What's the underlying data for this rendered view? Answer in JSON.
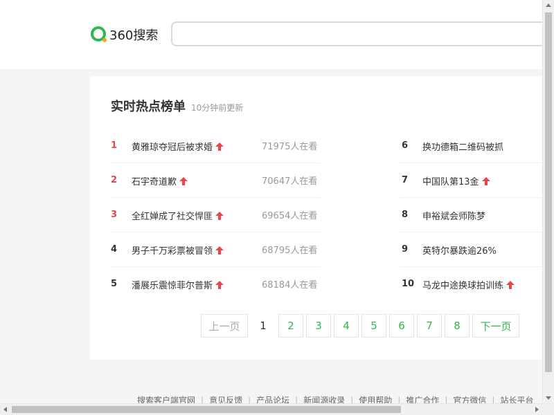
{
  "header": {
    "logo_text": "360搜索",
    "search_value": "",
    "search_placeholder": ""
  },
  "panel": {
    "title": "实时热点榜单",
    "subtitle": "10分钟前更新",
    "left_items": [
      {
        "rank": "1",
        "title": "黄雅琼夺冠后被求婚",
        "views": "71975人在看",
        "trend": "up",
        "rank_color": "#e9464a"
      },
      {
        "rank": "2",
        "title": "石宇奇道歉",
        "views": "70647人在看",
        "trend": "up",
        "rank_color": "#e9464a"
      },
      {
        "rank": "3",
        "title": "全红婵成了社交悍匪",
        "views": "69654人在看",
        "trend": "up",
        "rank_color": "#e9464a"
      },
      {
        "rank": "4",
        "title": "男子千万彩票被冒领",
        "views": "68795人在看",
        "trend": "up",
        "rank_color": "#333333"
      },
      {
        "rank": "5",
        "title": "潘展乐震惊菲尔普斯",
        "views": "68184人在看",
        "trend": "up",
        "rank_color": "#333333"
      }
    ],
    "right_items": [
      {
        "rank": "6",
        "title": "换功德箱二维码被抓",
        "trend": "none"
      },
      {
        "rank": "7",
        "title": "中国队第13金",
        "trend": "up"
      },
      {
        "rank": "8",
        "title": "申裕斌会师陈梦",
        "trend": "none"
      },
      {
        "rank": "9",
        "title": "英特尔暴跌逾26%",
        "trend": "none"
      },
      {
        "rank": "10",
        "title": "马龙中途换球拍训练",
        "trend": "up"
      }
    ]
  },
  "pagination": {
    "prev_label": "上一页",
    "next_label": "下一页",
    "pages": [
      "1",
      "2",
      "3",
      "4",
      "5",
      "6",
      "7",
      "8"
    ],
    "current": "1"
  },
  "footer": {
    "links": [
      "搜索客户端官网",
      "意见反馈",
      "产品论坛",
      "新闻源收录",
      "使用帮助",
      "推广合作",
      "官方微信",
      "站长平台"
    ]
  },
  "colors": {
    "accent_green": "#2eb84f",
    "hot_red": "#e9464a",
    "trend_up": "#e9464a"
  }
}
